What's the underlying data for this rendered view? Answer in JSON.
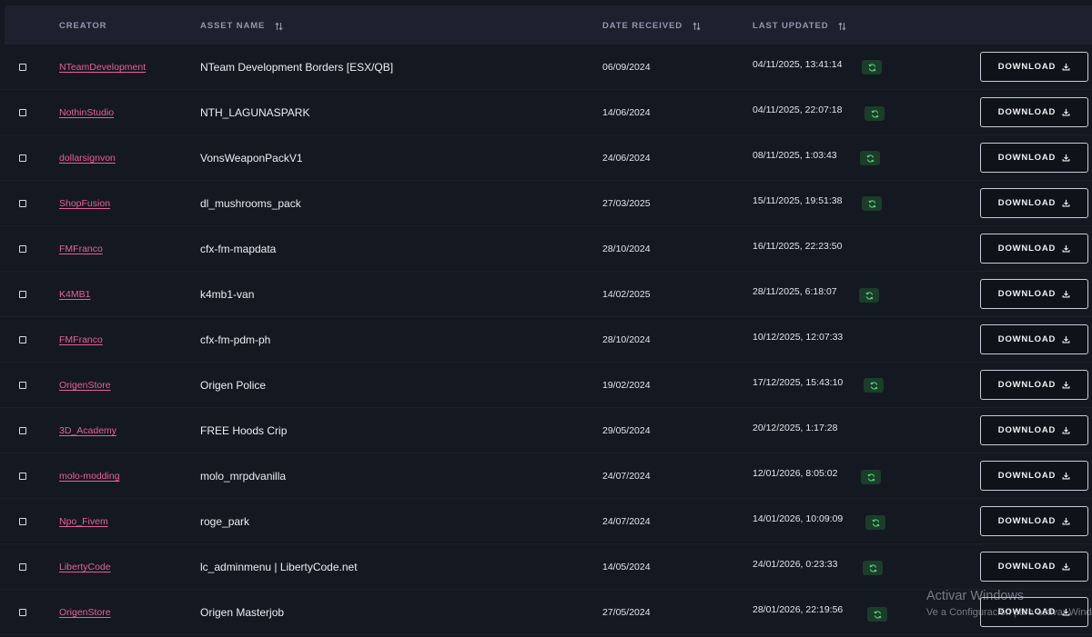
{
  "table": {
    "headers": {
      "creator": "CREATOR",
      "asset_name": "ASSET NAME",
      "date_received": "DATE RECEIVED",
      "last_updated": "LAST UPDATED"
    },
    "download_label": "DOWNLOAD",
    "rows": [
      {
        "creator": "NTeamDevelopment",
        "asset": "NTeam Development Borders [ESX/QB]",
        "date_received": "06/09/2024",
        "last_updated": "04/11/2025, 13:41:14",
        "has_update_icon": true
      },
      {
        "creator": "NothinStudio",
        "asset": "NTH_LAGUNASPARK",
        "date_received": "14/06/2024",
        "last_updated": "04/11/2025, 22:07:18",
        "has_update_icon": true
      },
      {
        "creator": "dollarsignvon",
        "asset": "VonsWeaponPackV1",
        "date_received": "24/06/2024",
        "last_updated": "08/11/2025, 1:03:43",
        "has_update_icon": true
      },
      {
        "creator": "ShopFusion",
        "asset": "dl_mushrooms_pack",
        "date_received": "27/03/2025",
        "last_updated": "15/11/2025, 19:51:38",
        "has_update_icon": true
      },
      {
        "creator": "FMFranco",
        "asset": "cfx-fm-mapdata",
        "date_received": "28/10/2024",
        "last_updated": "16/11/2025, 22:23:50",
        "has_update_icon": false
      },
      {
        "creator": "K4MB1",
        "asset": "k4mb1-van",
        "date_received": "14/02/2025",
        "last_updated": "28/11/2025, 6:18:07",
        "has_update_icon": true
      },
      {
        "creator": "FMFranco",
        "asset": "cfx-fm-pdm-ph",
        "date_received": "28/10/2024",
        "last_updated": "10/12/2025, 12:07:33",
        "has_update_icon": false
      },
      {
        "creator": "OrigenStore",
        "asset": "Origen Police",
        "date_received": "19/02/2024",
        "last_updated": "17/12/2025, 15:43:10",
        "has_update_icon": true
      },
      {
        "creator": "3D_Academy",
        "asset": "FREE Hoods Crip",
        "date_received": "29/05/2024",
        "last_updated": "20/12/2025, 1:17:28",
        "has_update_icon": false
      },
      {
        "creator": "molo-modding",
        "asset": "molo_mrpdvanilla",
        "date_received": "24/07/2024",
        "last_updated": "12/01/2026, 8:05:02",
        "has_update_icon": true
      },
      {
        "creator": "Npo_Fivem",
        "asset": "roge_park",
        "date_received": "24/07/2024",
        "last_updated": "14/01/2026, 10:09:09",
        "has_update_icon": true
      },
      {
        "creator": "LibertyCode",
        "asset": "lc_adminmenu | LibertyCode.net",
        "date_received": "14/05/2024",
        "last_updated": "24/01/2026, 0:23:33",
        "has_update_icon": true
      },
      {
        "creator": "OrigenStore",
        "asset": "Origen Masterjob",
        "date_received": "27/05/2024",
        "last_updated": "28/01/2026, 22:19:56",
        "has_update_icon": true
      }
    ]
  },
  "watermark": {
    "title": "Activar Windows",
    "subtitle": "Ve a Configuración para activar Windows."
  },
  "colors": {
    "background": "#141821",
    "header_bg": "#1c212d",
    "creator_link": "#e8609a",
    "refresh_badge_bg": "#1b3d2a",
    "refresh_icon": "#4fd37a"
  },
  "icons": {
    "sort": "sort-arrows-icon",
    "refresh": "refresh-icon",
    "download": "download-icon"
  }
}
